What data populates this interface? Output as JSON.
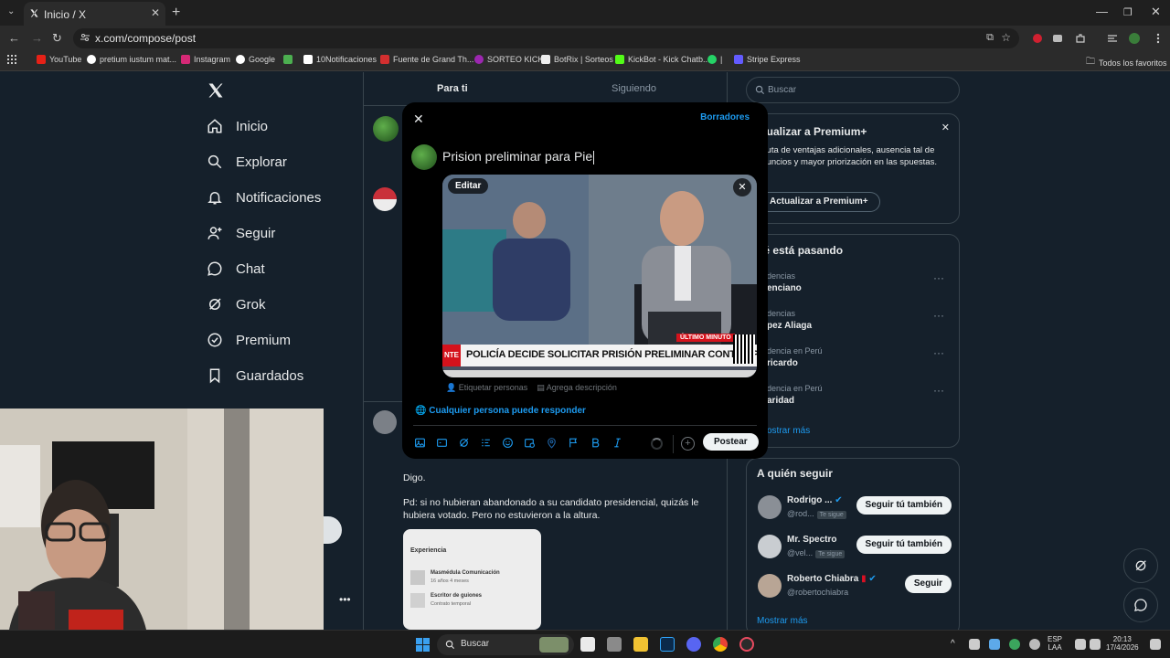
{
  "browser": {
    "tab_title": "Inicio / X",
    "url": "x.com/compose/post",
    "bookmarks": [
      "YouTube",
      "pretium iustum mat...",
      "Instagram",
      "Google",
      "10Notificaciones",
      "Fuente de Grand Th...",
      "SORTEO KICK",
      "BotRix | Sorteos",
      "KickBot - Kick Chatb...",
      "|",
      "Stripe Express"
    ],
    "all_bookmarks": "Todos los favoritos"
  },
  "nav": {
    "items": [
      "Inicio",
      "Explorar",
      "Notificaciones",
      "Seguir",
      "Chat",
      "Grok",
      "Premium",
      "Guardados"
    ]
  },
  "feed": {
    "tabs": [
      "Para ti",
      "Siguiendo"
    ],
    "post_text_1": "Digo.",
    "post_text_2": "Pd: si no hubieran abandonado a su candidato presidencial, quizás le hubiera votado. Pero no estuvieron a la altura.",
    "card_title": "Experiencia",
    "card_item_1": "Masmédula Comunicación",
    "card_item_1_sub": "16 años 4 meses",
    "card_item_2": "Escritor de guiones",
    "card_item_2_sub": "Contrato temporal"
  },
  "sidebar": {
    "search_placeholder": "Buscar",
    "premium_title": "ctualizar a Premium+",
    "premium_text": "sfruta de ventajas adicionales, ausencia tal de anuncios y mayor priorización en las spuestas.",
    "premium_button": "Actualizar a Premium+",
    "trends_title": "ué está pasando",
    "trends": [
      {
        "category": "dencias",
        "name": "enciano"
      },
      {
        "category": "dencias",
        "name": "pez Aliaga"
      },
      {
        "category": "dencia en Perú",
        "name": "ricardo"
      },
      {
        "category": "dencia en Perú",
        "name": "aridad"
      }
    ],
    "show_more": "ostrar más",
    "who_to_follow": "A quién seguir",
    "follow": [
      {
        "name": "Rodrigo ...",
        "handle": "@rod...",
        "badge": "Te sigue",
        "button": "Seguir tú también"
      },
      {
        "name": "Mr. Spectro",
        "handle": "@vel...",
        "badge": "Te sigue",
        "button": "Seguir tú también"
      },
      {
        "name": "Roberto Chiabra",
        "handle": "@robertochiabra",
        "badge": "",
        "button": "Seguir"
      }
    ],
    "show_more_2": "Mostrar más"
  },
  "compose": {
    "drafts": "Borradores",
    "text": "Prision preliminar para Pie",
    "edit": "Editar",
    "headline": "POLICÍA DECIDE SOLICITAR PRISIÓN PRELIMINAR CONTRA PIERO CORVETTO",
    "live_tag": "ÚLTIMO MINUTO",
    "side_tag": "NTE",
    "tag_people": "Etiquetar personas",
    "add_description": "Agrega descripción",
    "reply_setting": "Cualquier persona puede responder",
    "post_button": "Postear"
  },
  "taskbar": {
    "search": "Buscar",
    "lang": "ESP",
    "lang2": "LAA",
    "time": "20:13",
    "date": "17/4/2026"
  }
}
